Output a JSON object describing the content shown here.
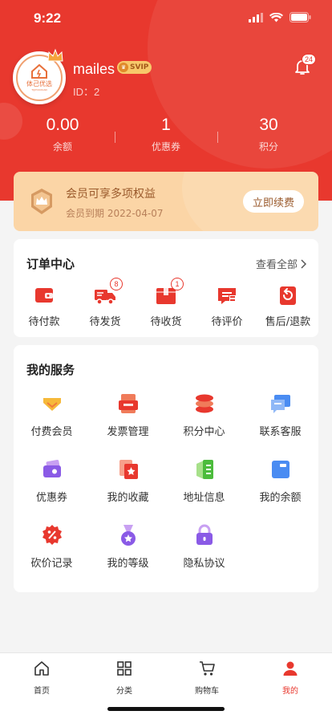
{
  "status_bar": {
    "time": "9:22"
  },
  "profile": {
    "logo_text": "体己优选",
    "logo_sub": "TIJIYOUXUAN",
    "username": "mailes",
    "vip_badge": "SVIP",
    "user_id": "ID：2",
    "notification_count": "24"
  },
  "stats": [
    {
      "value": "0.00",
      "label": "余额"
    },
    {
      "value": "1",
      "label": "优惠券"
    },
    {
      "value": "30",
      "label": "积分"
    }
  ],
  "membership": {
    "title": "会员可享多项权益",
    "expiry": "会员到期  2022-04-07",
    "renew_label": "立即续费"
  },
  "orders": {
    "title": "订单中心",
    "view_all": "查看全部",
    "items": [
      {
        "label": "待付款",
        "icon": "wallet-icon",
        "badge": ""
      },
      {
        "label": "待发货",
        "icon": "truck-icon",
        "badge": "8"
      },
      {
        "label": "待收货",
        "icon": "package-icon",
        "badge": "1"
      },
      {
        "label": "待评价",
        "icon": "comment-icon",
        "badge": ""
      },
      {
        "label": "售后/退款",
        "icon": "refund-icon",
        "badge": ""
      }
    ]
  },
  "services": {
    "title": "我的服务",
    "items": [
      {
        "label": "付费会员",
        "icon": "diamond-icon"
      },
      {
        "label": "发票管理",
        "icon": "invoice-icon"
      },
      {
        "label": "积分中心",
        "icon": "coins-icon"
      },
      {
        "label": "联系客服",
        "icon": "chat-icon"
      },
      {
        "label": "优惠券",
        "icon": "coupon-icon"
      },
      {
        "label": "我的收藏",
        "icon": "star-icon"
      },
      {
        "label": "地址信息",
        "icon": "address-icon"
      },
      {
        "label": "我的余额",
        "icon": "balance-icon"
      },
      {
        "label": "砍价记录",
        "icon": "discount-icon"
      },
      {
        "label": "我的等级",
        "icon": "medal-icon"
      },
      {
        "label": "隐私协议",
        "icon": "lock-icon"
      }
    ]
  },
  "tabbar": [
    {
      "label": "首页",
      "icon": "home-icon"
    },
    {
      "label": "分类",
      "icon": "grid-icon"
    },
    {
      "label": "购物车",
      "icon": "cart-icon"
    },
    {
      "label": "我的",
      "icon": "user-icon"
    }
  ],
  "colors": {
    "primary": "#e8382e",
    "vip_bg": "#fbd5a6",
    "vip_text": "#9a5a2c"
  }
}
